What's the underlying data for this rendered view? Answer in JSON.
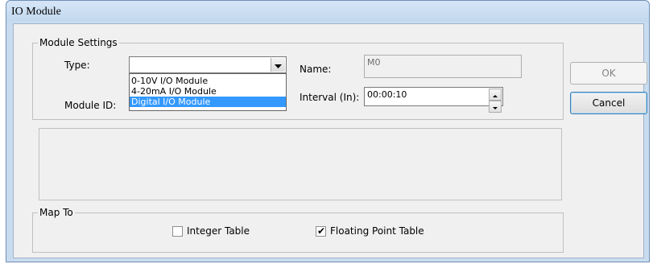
{
  "window": {
    "title": "IO Module"
  },
  "module_settings": {
    "legend": "Module Settings",
    "type_label": "Type:",
    "type_value": "",
    "type_options": [
      {
        "label": "0-10V I/O Module",
        "selected": false
      },
      {
        "label": "4-20mA I/O Module",
        "selected": false
      },
      {
        "label": "Digital I/O Module",
        "selected": true
      }
    ],
    "module_id_label": "Module ID:",
    "name_label": "Name:",
    "name_value": "M0",
    "interval_label": "Interval (In):",
    "interval_value": "00:00:10"
  },
  "buttons": {
    "ok": "OK",
    "cancel": "Cancel"
  },
  "map_to": {
    "legend": "Map To",
    "integer_table_label": "Integer Table",
    "integer_table_checked": false,
    "floating_point_table_label": "Floating Point Table",
    "floating_point_table_checked": true
  },
  "icons": {
    "dropdown_arrow": "chevron-down-icon",
    "spin_up": "spin-up-icon",
    "spin_down": "spin-down-icon",
    "check": "check-icon"
  }
}
